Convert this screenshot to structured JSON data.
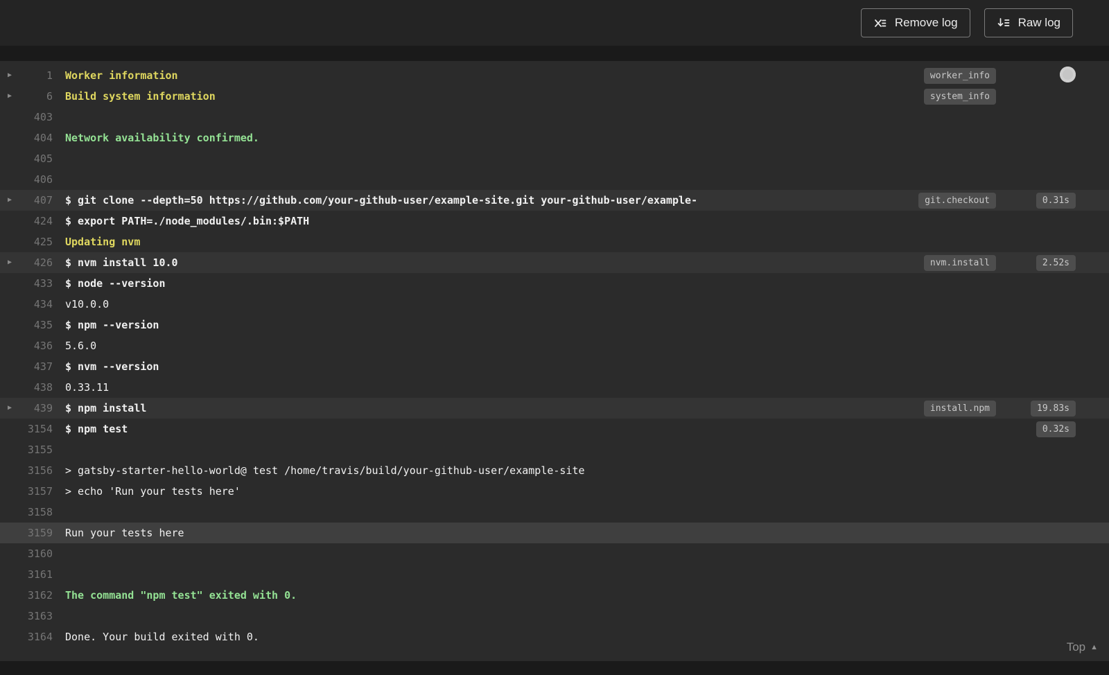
{
  "theme": {
    "header_bg": "#242424",
    "log_bg": "#2b2b2b",
    "command_row_bg": "#343434",
    "selected_row_bg": "#3f3f3f",
    "yellow": "#dfd75f",
    "green": "#94e294",
    "text": "#f1f1f1"
  },
  "header": {
    "remove_log_label": "Remove log",
    "raw_log_label": "Raw log"
  },
  "log": {
    "lines": [
      {
        "number": "1",
        "text": "Worker information",
        "style": "yellow",
        "fold": true,
        "tag": "worker_info"
      },
      {
        "number": "6",
        "text": "Build system information",
        "style": "yellow",
        "fold": true,
        "tag": "system_info"
      },
      {
        "number": "403",
        "text": ""
      },
      {
        "number": "404",
        "text": "Network availability confirmed.",
        "style": "green"
      },
      {
        "number": "405",
        "text": ""
      },
      {
        "number": "406",
        "text": ""
      },
      {
        "number": "407",
        "text": "$ git clone --depth=50 https://github.com/your-github-user/example-site.git your-github-user/example-",
        "style": "command",
        "fold": true,
        "tag": "git.checkout",
        "duration": "0.31s",
        "highlight": "command"
      },
      {
        "number": "424",
        "text": "$ export PATH=./node_modules/.bin:$PATH",
        "style": "command"
      },
      {
        "number": "425",
        "text": "Updating nvm",
        "style": "yellow"
      },
      {
        "number": "426",
        "text": "$ nvm install 10.0",
        "style": "command",
        "fold": true,
        "tag": "nvm.install",
        "duration": "2.52s",
        "highlight": "command"
      },
      {
        "number": "433",
        "text": "$ node --version",
        "style": "command"
      },
      {
        "number": "434",
        "text": "v10.0.0"
      },
      {
        "number": "435",
        "text": "$ npm --version",
        "style": "command"
      },
      {
        "number": "436",
        "text": "5.6.0"
      },
      {
        "number": "437",
        "text": "$ nvm --version",
        "style": "command"
      },
      {
        "number": "438",
        "text": "0.33.11"
      },
      {
        "number": "439",
        "text": "$ npm install",
        "style": "command",
        "fold": true,
        "tag": "install.npm",
        "duration": "19.83s",
        "highlight": "command"
      },
      {
        "number": "3154",
        "text": "$ npm test",
        "style": "command",
        "duration": "0.32s"
      },
      {
        "number": "3155",
        "text": ""
      },
      {
        "number": "3156",
        "text": "> gatsby-starter-hello-world@ test /home/travis/build/your-github-user/example-site"
      },
      {
        "number": "3157",
        "text": "> echo 'Run your tests here'"
      },
      {
        "number": "3158",
        "text": ""
      },
      {
        "number": "3159",
        "text": "Run your tests here",
        "highlight": "selected"
      },
      {
        "number": "3160",
        "text": ""
      },
      {
        "number": "3161",
        "text": ""
      },
      {
        "number": "3162",
        "text": "The command \"npm test\" exited with 0.",
        "style": "green"
      },
      {
        "number": "3163",
        "text": ""
      },
      {
        "number": "3164",
        "text": "Done. Your build exited with 0."
      }
    ]
  },
  "footer": {
    "top_label": "Top"
  }
}
